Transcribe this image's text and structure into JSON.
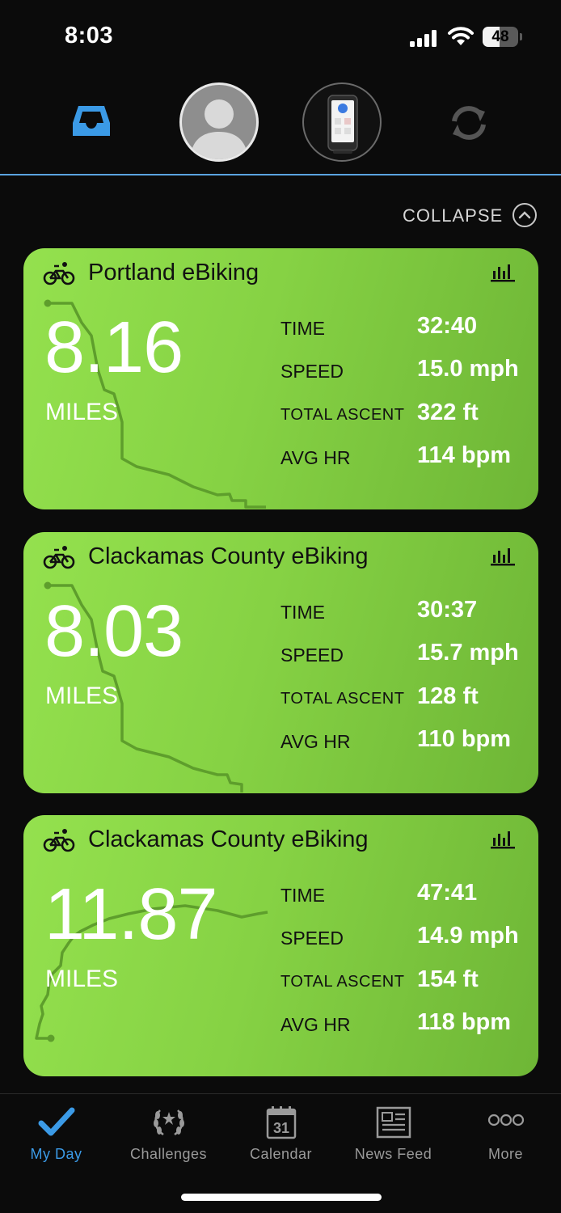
{
  "status_bar": {
    "time": "8:03",
    "battery": "48",
    "battery_level": 0.48
  },
  "header": {
    "icons": [
      "inbox-icon",
      "profile-avatar",
      "bike-computer-device",
      "sync-icon"
    ],
    "accent_color": "#5aa3e0"
  },
  "collapse": {
    "label": "COLLAPSE"
  },
  "activities": [
    {
      "title": "Portland eBiking",
      "distance": "8.16",
      "unit": "MILES",
      "stats": [
        {
          "label": "TIME",
          "value": "32:40"
        },
        {
          "label": "SPEED",
          "value": "15.0 mph"
        },
        {
          "label": "TOTAL ASCENT",
          "value": "322 ft"
        },
        {
          "label": "AVG HR",
          "value": "114 bpm"
        }
      ]
    },
    {
      "title": "Clackamas County eBiking",
      "distance": "8.03",
      "unit": "MILES",
      "stats": [
        {
          "label": "TIME",
          "value": "30:37"
        },
        {
          "label": "SPEED",
          "value": "15.7 mph"
        },
        {
          "label": "TOTAL ASCENT",
          "value": "128 ft"
        },
        {
          "label": "AVG HR",
          "value": "110 bpm"
        }
      ]
    },
    {
      "title": "Clackamas County eBiking",
      "distance": "11.87",
      "unit": "MILES",
      "stats": [
        {
          "label": "TIME",
          "value": "47:41"
        },
        {
          "label": "SPEED",
          "value": "14.9 mph"
        },
        {
          "label": "TOTAL ASCENT",
          "value": "154 ft"
        },
        {
          "label": "AVG HR",
          "value": "118 bpm"
        }
      ]
    }
  ],
  "card_color": "#86d244",
  "tabbar": {
    "active_color": "#3b9ae6",
    "tabs": [
      {
        "label": "My Day",
        "icon": "checkmark-icon",
        "active": true
      },
      {
        "label": "Challenges",
        "icon": "laurel-icon",
        "active": false
      },
      {
        "label": "Calendar",
        "icon": "calendar-icon",
        "calendar_day": "31",
        "active": false
      },
      {
        "label": "News Feed",
        "icon": "newspaper-icon",
        "active": false
      },
      {
        "label": "More",
        "icon": "more-dots-icon",
        "active": false
      }
    ]
  }
}
